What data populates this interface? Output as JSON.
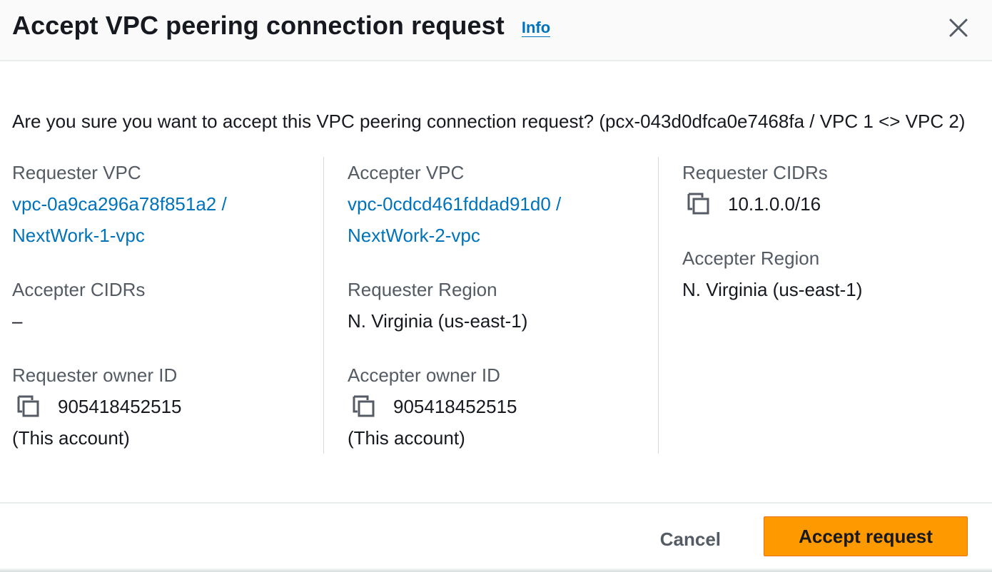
{
  "header": {
    "title": "Accept VPC peering connection request",
    "info_label": "Info",
    "close_icon": "close-icon"
  },
  "question": "Are you sure you want to accept this VPC peering connection request? (pcx-043d0dfca0e7468fa / VPC 1 <> VPC 2)",
  "col1": {
    "requester_vpc_label": "Requester VPC",
    "requester_vpc_line1": "vpc-0a9ca296a78f851a2 /",
    "requester_vpc_line2": "NextWork-1-vpc",
    "accepter_cidrs_label": "Accepter CIDRs",
    "accepter_cidrs_value": "–",
    "requester_owner_label": "Requester owner ID",
    "requester_owner_value": "905418452515",
    "requester_owner_note": "(This account)"
  },
  "col2": {
    "accepter_vpc_label": "Accepter VPC",
    "accepter_vpc_line1": "vpc-0cdcd461fddad91d0 /",
    "accepter_vpc_line2": "NextWork-2-vpc",
    "requester_region_label": "Requester Region",
    "requester_region_value": "N. Virginia (us-east-1)",
    "accepter_owner_label": "Accepter owner ID",
    "accepter_owner_value": "905418452515",
    "accepter_owner_note": "(This account)"
  },
  "col3": {
    "requester_cidrs_label": "Requester CIDRs",
    "requester_cidrs_value": "10.1.0.0/16",
    "accepter_region_label": "Accepter Region",
    "accepter_region_value": "N. Virginia (us-east-1)"
  },
  "footer": {
    "cancel_label": "Cancel",
    "accept_label": "Accept request"
  },
  "colors": {
    "link": "#0073bb",
    "primary_button": "#ff9900",
    "label_text": "#545b64"
  }
}
